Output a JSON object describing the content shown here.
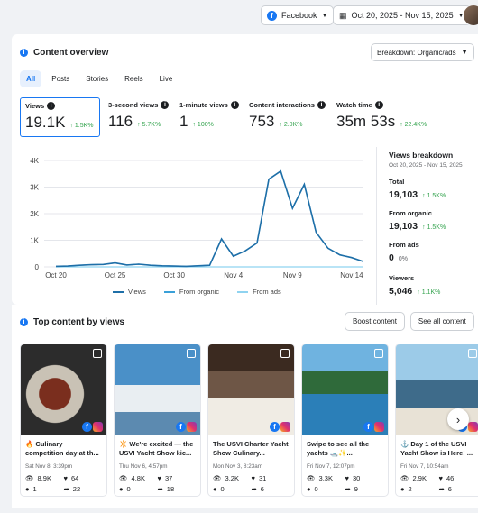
{
  "topbar": {
    "platform": "Facebook",
    "date_range": "Oct 20, 2025 - Nov 15, 2025"
  },
  "overview": {
    "title": "Content overview",
    "breakdown_select": "Breakdown: Organic/ads",
    "tabs": [
      "All",
      "Posts",
      "Stories",
      "Reels",
      "Live"
    ],
    "active_tab": "All",
    "metrics": [
      {
        "label": "Views",
        "value": "19.1K",
        "change": "1.5K%"
      },
      {
        "label": "3-second views",
        "value": "116",
        "change": "5.7K%"
      },
      {
        "label": "1-minute views",
        "value": "1",
        "change": "100%"
      },
      {
        "label": "Content interactions",
        "value": "753",
        "change": "2.0K%"
      },
      {
        "label": "Watch time",
        "value": "35m 53s",
        "change": "22.4K%"
      }
    ],
    "legend": [
      "Views",
      "From organic",
      "From ads"
    ]
  },
  "chart_data": {
    "type": "line",
    "x": [
      "Oct 20",
      "Oct 21",
      "Oct 22",
      "Oct 23",
      "Oct 24",
      "Oct 25",
      "Oct 26",
      "Oct 27",
      "Oct 28",
      "Oct 29",
      "Oct 30",
      "Oct 31",
      "Nov 1",
      "Nov 2",
      "Nov 3",
      "Nov 4",
      "Nov 5",
      "Nov 6",
      "Nov 7",
      "Nov 8",
      "Nov 9",
      "Nov 10",
      "Nov 11",
      "Nov 12",
      "Nov 13",
      "Nov 14",
      "Nov 15"
    ],
    "xticks": [
      "Oct 20",
      "Oct 25",
      "Oct 30",
      "Nov 4",
      "Nov 9",
      "Nov 14"
    ],
    "yticks": [
      "0",
      "1K",
      "2K",
      "3K",
      "4K"
    ],
    "ylim": [
      0,
      4000
    ],
    "series": [
      {
        "name": "Views",
        "values": [
          20,
          30,
          60,
          80,
          90,
          150,
          70,
          100,
          60,
          40,
          30,
          20,
          40,
          60,
          1050,
          400,
          600,
          900,
          3300,
          3600,
          2200,
          3100,
          1300,
          700,
          450,
          350,
          200
        ]
      },
      {
        "name": "From organic",
        "values": [
          20,
          30,
          60,
          80,
          90,
          150,
          70,
          100,
          60,
          40,
          30,
          20,
          40,
          60,
          1050,
          400,
          600,
          900,
          3300,
          3600,
          2200,
          3100,
          1300,
          700,
          450,
          350,
          200
        ]
      },
      {
        "name": "From ads",
        "values": [
          0,
          0,
          0,
          0,
          0,
          0,
          0,
          0,
          0,
          0,
          0,
          0,
          0,
          0,
          0,
          0,
          0,
          0,
          0,
          0,
          0,
          0,
          0,
          0,
          0,
          0,
          0
        ]
      }
    ],
    "colors": {
      "views": "#1e6fa8",
      "organic": "#3aa0d8",
      "ads": "#8fd3f0"
    }
  },
  "breakdown": {
    "title": "Views breakdown",
    "range": "Oct 20, 2025 - Nov 15, 2025",
    "total_label": "Total",
    "total_value": "19,103",
    "total_change": "1.5K%",
    "organic_label": "From organic",
    "organic_value": "19,103",
    "organic_change": "1.5K%",
    "ads_label": "From ads",
    "ads_value": "0",
    "ads_pct": "0%",
    "viewers_label": "Viewers",
    "viewers_value": "5,046",
    "viewers_change": "1.1K%"
  },
  "top_content": {
    "title": "Top content by views",
    "boost_label": "Boost content",
    "see_all_label": "See all content",
    "posts": [
      {
        "title": "🔥 Culinary competition day at th...",
        "date": "Sat Nov 8, 3:39pm",
        "views": "8.9K",
        "likes": "64",
        "comments": "1",
        "shares": "22"
      },
      {
        "title": "🔆 We're excited — the USVI Yacht Show kic...",
        "date": "Thu Nov 6, 4:57pm",
        "views": "4.8K",
        "likes": "37",
        "comments": "0",
        "shares": "18"
      },
      {
        "title": "The USVI Charter Yacht Show Culinary...",
        "date": "Mon Nov 3, 8:23am",
        "views": "3.2K",
        "likes": "31",
        "comments": "0",
        "shares": "6"
      },
      {
        "title": "Swipe to see all the yachts 🛥️✨...",
        "date": "Fri Nov 7, 12:07pm",
        "views": "3.3K",
        "likes": "30",
        "comments": "0",
        "shares": "9"
      },
      {
        "title": "⚓ Day 1 of the USVI Yacht Show is Here! ...",
        "date": "Fri Nov 7, 10:54am",
        "views": "2.9K",
        "likes": "46",
        "comments": "2",
        "shares": "6"
      }
    ]
  }
}
